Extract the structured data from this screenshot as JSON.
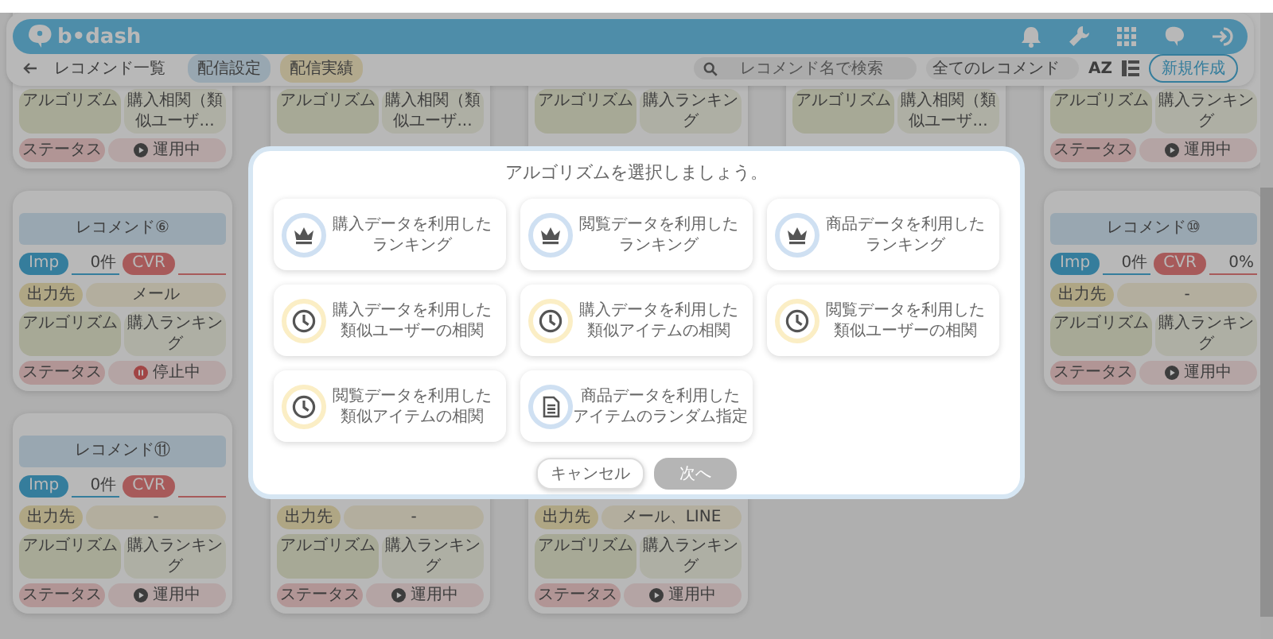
{
  "header": {
    "logo": "b•dash"
  },
  "subnav": {
    "back_label": "レコメンド一覧",
    "tabs": [
      {
        "label": "配信設定",
        "selected": true
      },
      {
        "label": "配信実績",
        "selected": false
      }
    ],
    "search": {
      "placeholder": "レコメンド名で検索"
    },
    "filter": {
      "value": "全てのレコメンド"
    },
    "sort_label": "AZ",
    "create_button": "新規作成"
  },
  "card_rows": [
    {
      "cards": [
        {
          "rows": [
            {
              "kind": "algorithm",
              "label": "アルゴリズム",
              "value": "購入相関（類似ユーザ..."
            },
            {
              "kind": "status",
              "label": "ステータス",
              "value": "運用中",
              "running": true
            }
          ]
        },
        {
          "rows": [
            {
              "kind": "algorithm",
              "label": "アルゴリズム",
              "value": "購入相関（類似ユーザ..."
            }
          ]
        },
        {
          "rows": [
            {
              "kind": "algorithm",
              "label": "アルゴリズム",
              "value": "購入ランキング"
            }
          ]
        },
        {
          "rows": [
            {
              "kind": "algorithm",
              "label": "アルゴリズム",
              "value": "購入相関（類似ユーザ..."
            }
          ]
        },
        {
          "rows": [
            {
              "kind": "algorithm",
              "label": "アルゴリズム",
              "value": "購入ランキング"
            },
            {
              "kind": "status",
              "label": "ステータス",
              "value": "運用中",
              "running": true
            }
          ]
        }
      ]
    },
    {
      "cards": [
        {
          "title": "レコメンド⑥",
          "metrics": {
            "imp_label": "Imp",
            "imp_value": "0件",
            "cvr_label": "CVR"
          },
          "rows": [
            {
              "kind": "output",
              "label": "出力先",
              "value": "メール"
            },
            {
              "kind": "algorithm",
              "label": "アルゴリズム",
              "value": "購入ランキング"
            },
            {
              "kind": "status",
              "label": "ステータス",
              "value": "停止中",
              "running": false
            }
          ]
        },
        {
          "title": "レコメンド⑩",
          "metrics": {
            "imp_label": "Imp",
            "imp_value": "0件",
            "cvr_label": "CVR",
            "cvr_value": "0%"
          },
          "rows": [
            {
              "kind": "output",
              "label": "出力先",
              "value": "-"
            },
            {
              "kind": "algorithm",
              "label": "アルゴリズム",
              "value": "購入ランキング"
            },
            {
              "kind": "status",
              "label": "ステータス",
              "value": "運用中",
              "running": true
            }
          ]
        }
      ]
    },
    {
      "cards": [
        {
          "title": "レコメンド⑪",
          "metrics": {
            "imp_label": "Imp",
            "imp_value": "0件",
            "cvr_label": "CVR"
          },
          "rows": [
            {
              "kind": "output",
              "label": "出力先",
              "value": "-"
            },
            {
              "kind": "algorithm",
              "label": "アルゴリズム",
              "value": "購入ランキング"
            },
            {
              "kind": "status",
              "label": "ステータス",
              "value": "運用中",
              "running": true
            }
          ]
        },
        {
          "rows": [
            {
              "kind": "output",
              "label": "出力先",
              "value": "-"
            },
            {
              "kind": "algorithm",
              "label": "アルゴリズム",
              "value": "購入ランキング"
            },
            {
              "kind": "status",
              "label": "ステータス",
              "value": "運用中",
              "running": true
            }
          ]
        },
        {
          "rows": [
            {
              "kind": "output",
              "label": "出力先",
              "value": "メール、LINE"
            },
            {
              "kind": "algorithm",
              "label": "アルゴリズム",
              "value": "購入ランキング"
            },
            {
              "kind": "status",
              "label": "ステータス",
              "value": "運用中",
              "running": true
            }
          ]
        }
      ]
    }
  ],
  "modal": {
    "title": "アルゴリズムを選択しましょう。",
    "options": [
      {
        "kind": "ranking",
        "color": "#cfe0f2",
        "lines": [
          "購入データを利用した",
          "ランキング"
        ],
        "selected": false
      },
      {
        "kind": "ranking",
        "color": "#cfe0f2",
        "lines": [
          "閲覧データを利用した",
          "ランキング"
        ],
        "selected": false
      },
      {
        "kind": "ranking",
        "color": "#cfe0f2",
        "lines": [
          "商品データを利用した",
          "ランキング"
        ],
        "selected": false
      },
      {
        "kind": "correlation",
        "color": "#fbeec5",
        "lines": [
          "購入データを利用した",
          "類似ユーザーの相関"
        ],
        "selected": false
      },
      {
        "kind": "correlation",
        "color": "#fbeec5",
        "lines": [
          "購入データを利用した",
          "類似アイテムの相関"
        ],
        "selected": false
      },
      {
        "kind": "correlation",
        "color": "#fbeec5",
        "lines": [
          "閲覧データを利用した",
          "類似ユーザーの相関"
        ],
        "selected": false
      },
      {
        "kind": "correlation",
        "color": "#fbeec5",
        "lines": [
          "閲覧データを利用した",
          "類似アイテムの相関"
        ],
        "selected": false
      },
      {
        "kind": "random",
        "color": "#cfe0f2",
        "lines": [
          "商品データを利用した",
          "アイテムのランダム指定"
        ],
        "selected": false
      }
    ],
    "cancel_button": "キャンセル",
    "next_button": {
      "label": "次へ",
      "disabled": true
    }
  }
}
